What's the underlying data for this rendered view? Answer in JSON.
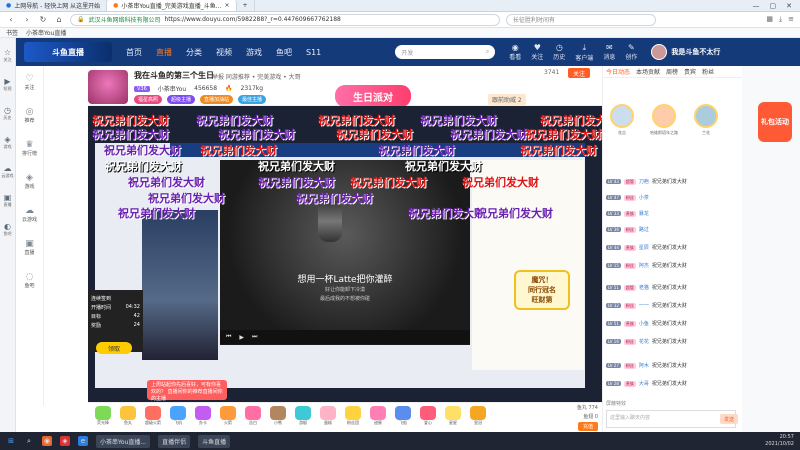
{
  "browser": {
    "tabs": [
      {
        "label": "上网导航 - 轻快上网 从这里开始"
      },
      {
        "label": "小茶串You直播_完美游戏直播_斗鱼..."
      }
    ],
    "url_secure_label": "武汉斗鱼网络科技有限公司",
    "url": "https://www.douyu.com/5982288?_r=0.447609667762188",
    "search_placeholder": "长征胜利时间有",
    "bookmarks": [
      "书签",
      "小茶串You直播"
    ],
    "sidebar": [
      "关注",
      "短视",
      "历史",
      "游戏",
      "云游戏",
      "直播",
      "鱼吧"
    ]
  },
  "douyu": {
    "logo_text": "斗鱼直播",
    "nav": [
      "首页",
      "直播",
      "分类",
      "视频",
      "游戏",
      "鱼吧",
      "S11"
    ],
    "search_placeholder": "开发",
    "header_icons": [
      "看看",
      "关注",
      "历史",
      "客户端",
      "消息",
      "创作"
    ],
    "username": "我是斗鱼不太行",
    "left_sidebar": [
      "关注",
      "推荐",
      "排行榜",
      "游戏",
      "云游戏",
      "直播",
      "鱼吧"
    ]
  },
  "room": {
    "title": "我在斗鱼的第三个生日",
    "meta": "举报  同游推荐 • 完美游戏 • 大哥",
    "anchor": "小茶串You",
    "anchor_id": "456658",
    "level": "V36",
    "hot": "2317kg",
    "tags": [
      "福星高照",
      "超级主播",
      "直播加油站",
      "最佳主播"
    ],
    "banner_text": "生日派对",
    "report": "跟前助威 2",
    "fans": "3741",
    "follow_label": "关注"
  },
  "video": {
    "lyric_main": "想用一杯Latte把你灌醉",
    "lyric_sub1": "好让你能卸下冷漠",
    "lyric_sub2": "最后成我的不想被你碰",
    "inner_title": "我在斗鱼的第三个生日",
    "task": {
      "name": "连续签到",
      "rows": [
        [
          "开播时间",
          "04:32"
        ],
        [
          "目标",
          "42"
        ],
        [
          "奖励",
          "24"
        ]
      ],
      "button": "领取"
    },
    "tooltip": "上周站起你先后喜好，可有你喜欢的？ 直播间你的推荐直播间你的主播"
  },
  "danmaku": {
    "text": "祝兄弟们发大财",
    "sticker_text": [
      "魔咒！",
      "同行冠名",
      "旺财第"
    ]
  },
  "gifts": [
    "荧光棒",
    "鱼丸",
    "超级火箭",
    "飞机",
    "办卡",
    "火箭",
    "告白",
    "小熊",
    "游艇",
    "蛋糕",
    "粉丝团",
    "甜蜜",
    "飞船",
    "爱心",
    "星星",
    "皇冠"
  ],
  "giftbar_info": {
    "balance1": "鱼丸 774",
    "balance2": "鱼翅 0",
    "charge_label": "充值"
  },
  "chat": {
    "tabs": [
      "今日动态",
      "本场贡献",
      "周榜",
      "贵宾",
      "粉丝"
    ],
    "rank_tabs": [
      "今日动态",
      "本场贡献",
      "周榜",
      "贵宾",
      "粉丝"
    ],
    "rank_users": [
      "花吉",
      "哈维斯塔年之路",
      "兰花"
    ],
    "messages": [
      {
        "lv": "LV 43",
        "badge": "超管",
        "name": "刀疤",
        "text": "祝兄弟们发大财"
      },
      {
        "lv": "LV 47",
        "badge": "粉丝",
        "name": "小茶",
        "text": ""
      },
      {
        "lv": "LV 33",
        "badge": "贵族",
        "name": "暴龙",
        "text": ""
      },
      {
        "lv": "LV 36",
        "badge": "粉丝",
        "name": "路过",
        "text": ""
      },
      {
        "lv": "LV 44",
        "badge": "贵族",
        "name": "星辰",
        "text": "祝兄弟们发大财"
      },
      {
        "lv": "LV 15",
        "badge": "粉丝",
        "name": "阿杰",
        "text": "祝兄弟们发大财"
      },
      {
        "lv": "LV 51",
        "badge": "超管",
        "name": "老猫",
        "text": "祝兄弟们发大财"
      },
      {
        "lv": "LV 32",
        "badge": "粉丝",
        "name": "一一",
        "text": "祝兄弟们发大财"
      },
      {
        "lv": "LV 51",
        "badge": "贵族",
        "name": "小鱼",
        "text": "祝兄弟们发大财"
      },
      {
        "lv": "LV 16",
        "badge": "粉丝",
        "name": "花花",
        "text": "祝兄弟们发大财"
      },
      {
        "lv": "LV 27",
        "badge": "粉丝",
        "name": "阿木",
        "text": "祝兄弟们发大财"
      },
      {
        "lv": "LV 28",
        "badge": "贵族",
        "name": "大哥",
        "text": "祝兄弟们发大财"
      }
    ],
    "input_placeholder": "这里输入聊天内容",
    "send_hint": "屏蔽特效",
    "send_label": "发送",
    "promo": "礼包活动"
  },
  "taskbar": {
    "windows": [
      "小茶串You直播...",
      "直播伴侣",
      "斗鱼直播"
    ],
    "time": "20:57",
    "date": "2021/10/02"
  }
}
